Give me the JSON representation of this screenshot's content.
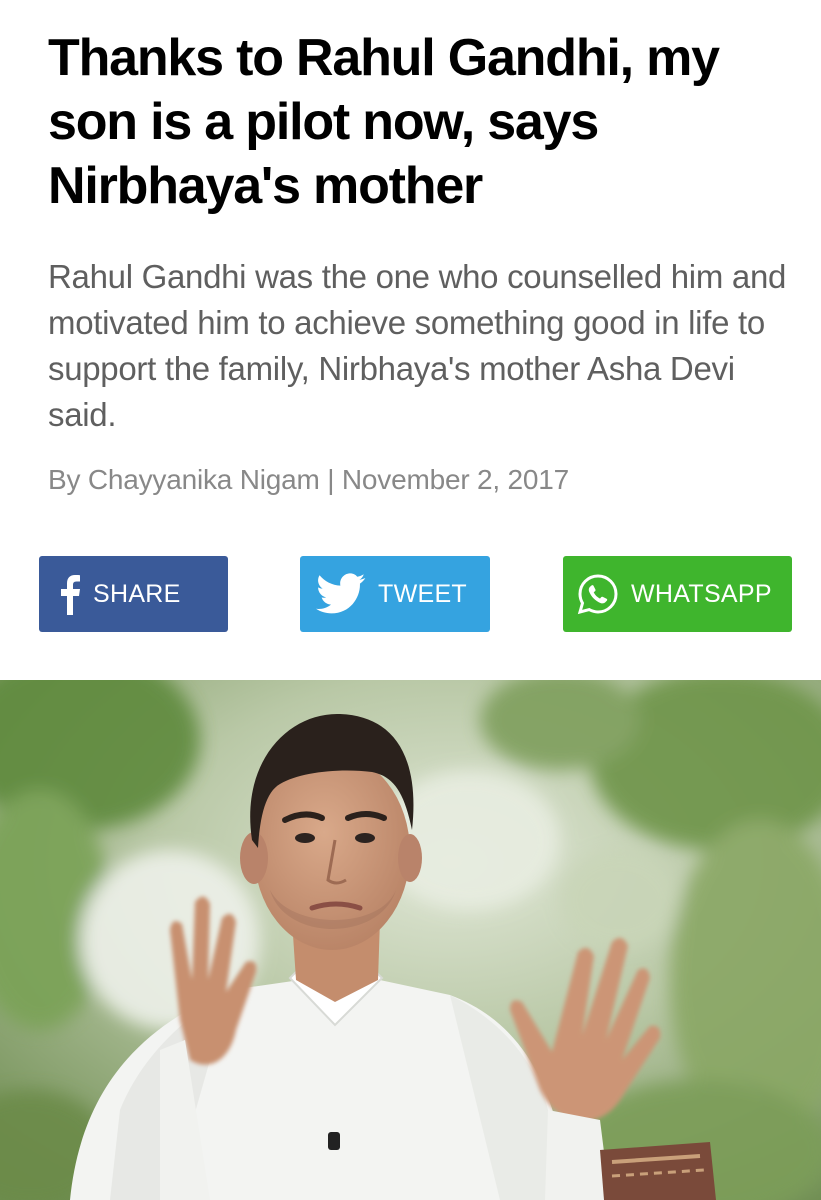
{
  "article": {
    "headline": "Thanks to Rahul Gandhi, my son is a pilot now, says Nirbhaya's mother",
    "summary": "Rahul Gandhi was the one who counselled him and motivated him to achieve something good in life to support the family, Nirbhaya's mother Asha Devi said.",
    "byline": "By Chayyanika Nigam | November 2, 2017"
  },
  "share": {
    "facebook": {
      "label": "SHARE",
      "icon": "facebook-icon",
      "color": "#3a5a99"
    },
    "twitter": {
      "label": "TWEET",
      "icon": "twitter-bird-icon",
      "color": "#35a3e0"
    },
    "whatsapp": {
      "label": "WHATSAPP",
      "icon": "whatsapp-icon",
      "color": "#3fb52d"
    }
  },
  "image": {
    "subject": "man-in-white-kurta-gesturing-outdoors"
  }
}
